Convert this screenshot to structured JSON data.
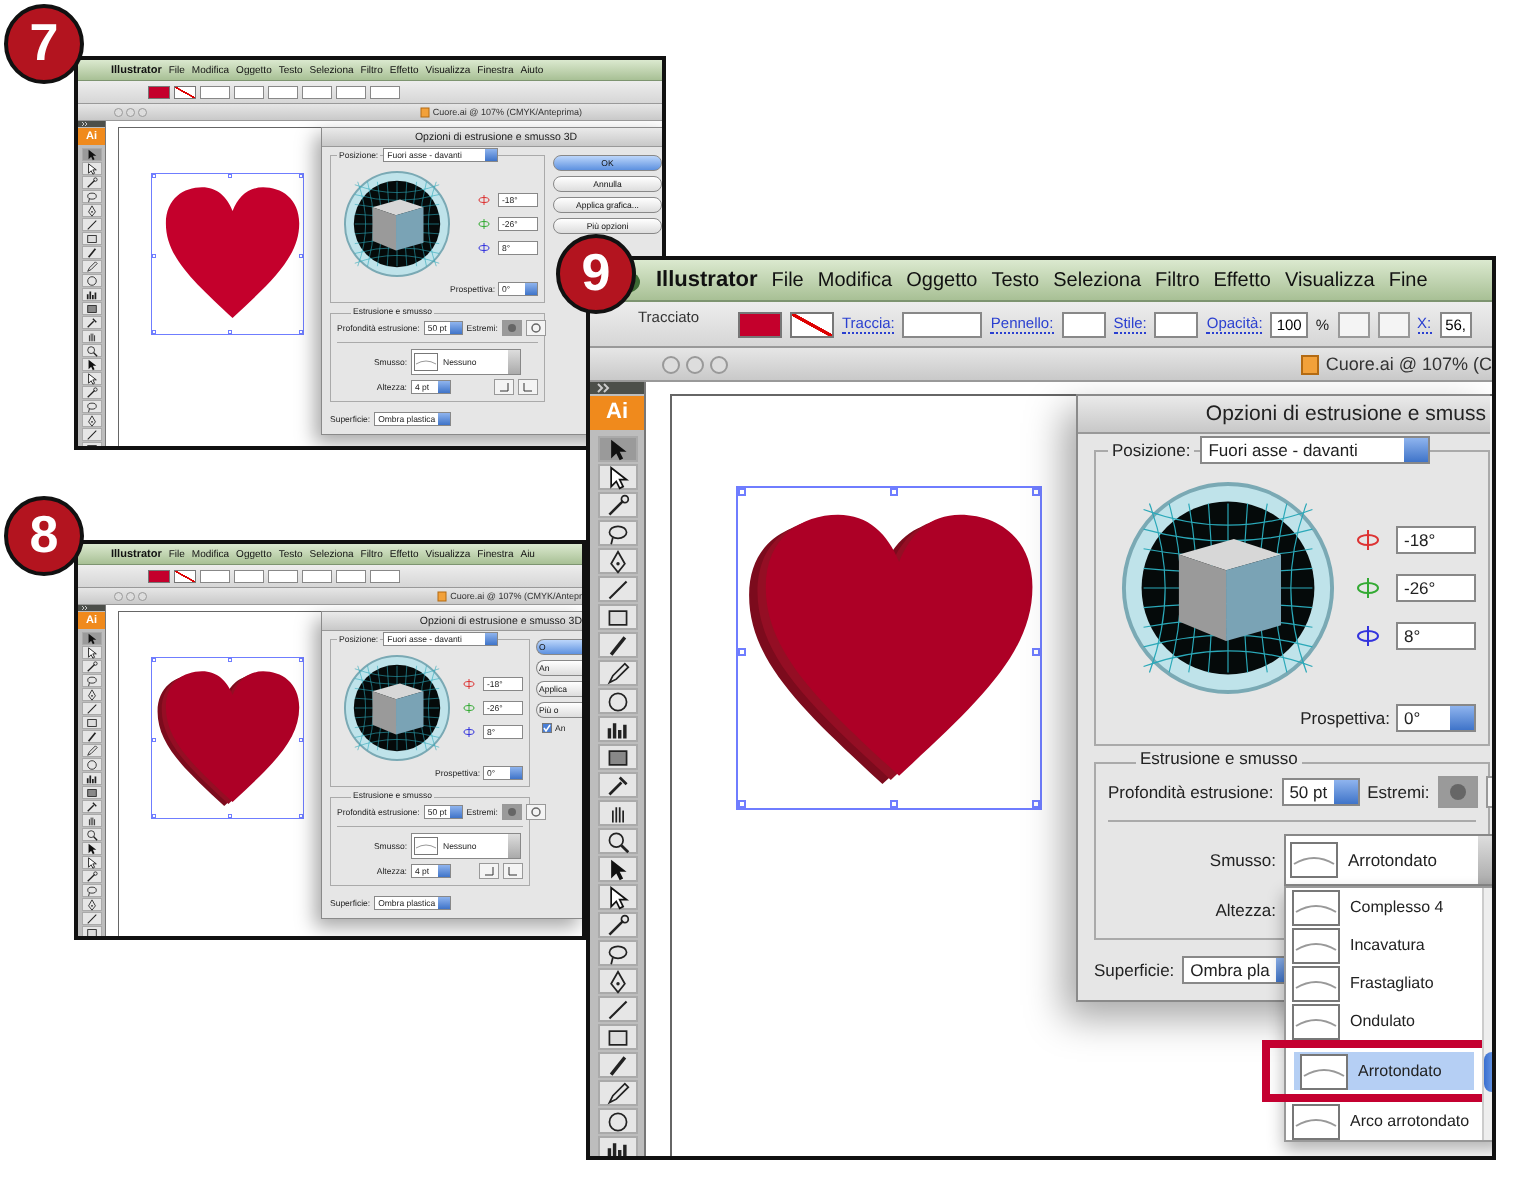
{
  "shots": [
    {
      "badge": "7",
      "menu": [
        "Illustrator",
        "File",
        "Modifica",
        "Oggetto",
        "Testo",
        "Seleziona",
        "Filtro",
        "Effetto",
        "Visualizza",
        "Finestra",
        "Aiuto"
      ],
      "document_title": "Cuore.ai @ 107% (CMYK/Anteprima)",
      "tools_logo": "Ai",
      "heart": {
        "kind": "flat"
      },
      "dialog": {
        "title": "Opzioni di estrusione e smusso 3D",
        "position_label": "Posizione:",
        "position_value": "Fuori asse - davanti",
        "angles": [
          "-18°",
          "-26°",
          "8°"
        ],
        "perspective_label": "Prospettiva:",
        "perspective_value": "0°",
        "extrude_group": "Estrusione e smusso",
        "depth_label": "Profondità estrusione:",
        "depth_value": "50 pt",
        "caps_label": "Estremi:",
        "bevel_label": "Smusso:",
        "bevel_value": "Nessuno",
        "height_label": "Altezza:",
        "height_value": "4 pt",
        "surface_label": "Superficie:",
        "surface_value": "Ombra plastica",
        "buttons": [
          {
            "label": "OK",
            "default": true
          },
          {
            "label": "Annulla",
            "default": false
          },
          {
            "label": "Applica grafica...",
            "default": false
          },
          {
            "label": "Più opzioni",
            "default": false
          }
        ]
      }
    },
    {
      "badge": "8",
      "menu": [
        "Illustrator",
        "File",
        "Modifica",
        "Oggetto",
        "Testo",
        "Seleziona",
        "Filtro",
        "Effetto",
        "Visualizza",
        "Finestra",
        "Aiu"
      ],
      "document_title": "Cuore.ai @ 107% (CMYK/Antepr",
      "tools_logo": "Ai",
      "heart": {
        "kind": "extruded"
      },
      "dialog": {
        "title": "Opzioni di estrusione e smusso 3D",
        "position_label": "Posizione:",
        "position_value": "Fuori asse - davanti",
        "angles": [
          "-18°",
          "-26°",
          "8°"
        ],
        "perspective_label": "Prospettiva:",
        "perspective_value": "0°",
        "extrude_group": "Estrusione e smusso",
        "depth_label": "Profondità estrusione:",
        "depth_value": "50 pt",
        "caps_label": "Estremi:",
        "bevel_label": "Smusso:",
        "bevel_value": "Nessuno",
        "height_label": "Altezza:",
        "height_value": "4 pt",
        "surface_label": "Superficie:",
        "surface_value": "Ombra plastica",
        "buttons": [
          {
            "label": "O",
            "default": true
          },
          {
            "label": "An",
            "default": false
          },
          {
            "label": "Applica",
            "default": false
          },
          {
            "label": "Più o",
            "default": false
          }
        ],
        "preview": {
          "label": "An",
          "checked": true
        }
      }
    },
    {
      "badge": "9",
      "app_icon": true,
      "menu": [
        "Illustrator",
        "File",
        "Modifica",
        "Oggetto",
        "Testo",
        "Seleziona",
        "Filtro",
        "Effetto",
        "Visualizza",
        "Fine"
      ],
      "control_bar": {
        "label": "Tracciato",
        "stroke_label": "Traccia:",
        "brush_label": "Pennello:",
        "style_label": "Stile:",
        "opacity_label": "Opacità:",
        "opacity_value": "100",
        "opacity_unit": "%",
        "x_label": "X:",
        "x_value": "56,"
      },
      "document_title": "Cuore.ai @ 107% (C",
      "tools_logo": "Ai",
      "heart": {
        "kind": "extruded"
      },
      "dialog": {
        "title": "Opzioni di estrusione e smuss",
        "position_label": "Posizione:",
        "position_value": "Fuori asse - davanti",
        "angles": [
          "-18°",
          "-26°",
          "8°"
        ],
        "perspective_label": "Prospettiva:",
        "perspective_value": "0°",
        "extrude_group": "Estrusione e smusso",
        "depth_label": "Profondità estrusione:",
        "depth_value": "50 pt",
        "caps_label": "Estremi:",
        "bevel_label": "Smusso:",
        "bevel_value": "Arrotondato",
        "height_label": "Altezza:",
        "surface_label": "Superficie:",
        "surface_value": "Ombra pla",
        "bevel_menu": {
          "callout": true,
          "items": [
            {
              "label": "Complesso 4",
              "selected": false
            },
            {
              "label": "Incavatura",
              "selected": false
            },
            {
              "label": "Frastagliato",
              "selected": false
            },
            {
              "label": "Ondulato",
              "selected": false
            },
            {
              "label": "Arrotondato",
              "selected": true
            },
            {
              "label": "Arco arrotondato",
              "selected": false
            }
          ]
        }
      }
    }
  ]
}
